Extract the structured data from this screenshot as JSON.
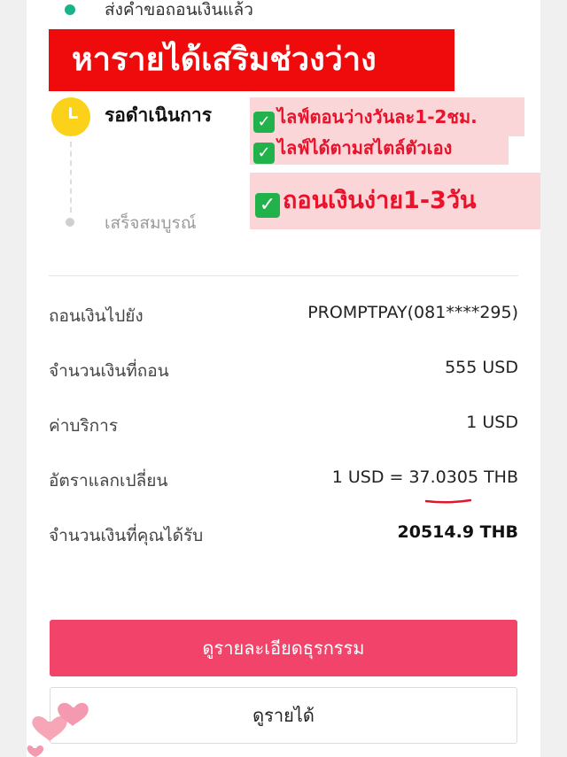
{
  "timeline": {
    "step_submitted": "ส่งคำขอถอนเงินแล้ว",
    "step_processing": "รอดำเนินการ",
    "step_completed": "เสร็จสมบูรณ์"
  },
  "overlay": {
    "banner": "หารายได้เสริมช่วงว่าง",
    "line1": "ไลฟ์ตอนว่างวันละ1-2ชม.",
    "line2": "ไลฟ์ได้ตามสไตล์ตัวเอง",
    "line3": "ถอนเงินง่าย1-3วัน",
    "check_glyph": "✓"
  },
  "details": [
    {
      "label": "ถอนเงินไปยัง",
      "value": "PROMPTPAY(081****295)"
    },
    {
      "label": "จำนวนเงินที่ถอน",
      "value": "555 USD"
    },
    {
      "label": "ค่าบริการ",
      "value": "1 USD"
    },
    {
      "label": "อัตราแลกเปลี่ยน",
      "value": "1 USD = 37.0305 THB"
    },
    {
      "label": "จำนวนเงินที่คุณได้รับ",
      "value": "20514.9 THB"
    }
  ],
  "buttons": {
    "view_transaction": "ดูรายละเอียดธุรกรรม",
    "view_income": "ดูรายได้"
  },
  "colors": {
    "accent": "#f2436a",
    "banner_red": "#ef0b0b",
    "pending_yellow": "#fbd11a",
    "done_green": "#19b38a",
    "check_green": "#22b24c"
  }
}
